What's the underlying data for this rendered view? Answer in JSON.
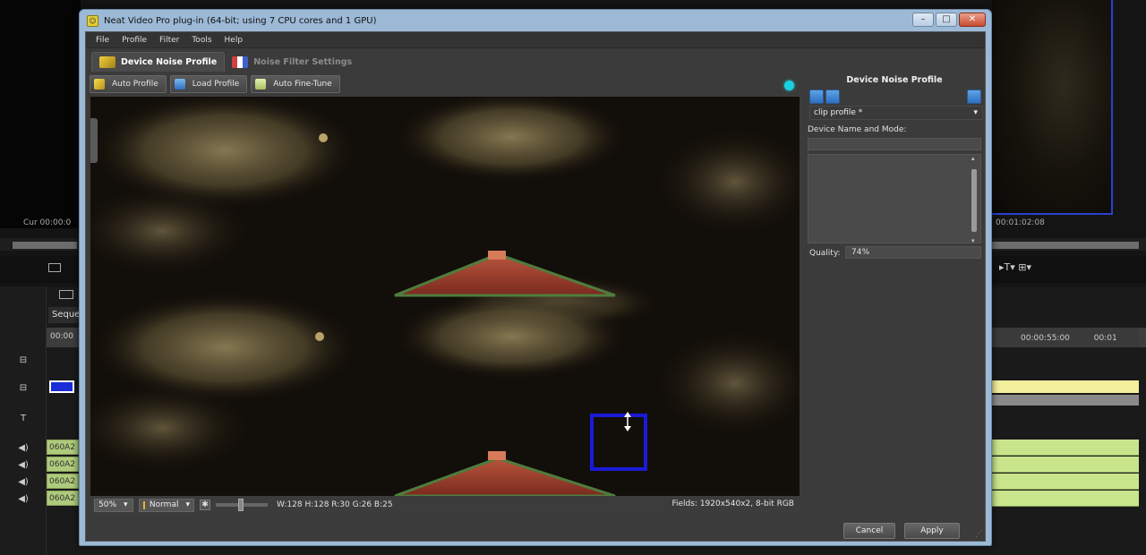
{
  "background_app": {
    "timecode_left": "Cur 00:00:0",
    "timecode_right": "00:01:02:08",
    "sequence_tab": "Seque",
    "ruler_left": "00:00",
    "ruler_right": "00:00:55:00",
    "ruler_far_right": "00:01",
    "clips": [
      "060A2",
      "060A2",
      "060A2",
      "060A2"
    ]
  },
  "dialog": {
    "title": "Neat Video Pro plug-in (64-bit; using 7 CPU cores and 1 GPU)",
    "window_buttons": [
      "–",
      "□",
      "✕"
    ],
    "menu": [
      "File",
      "Profile",
      "Filter",
      "Tools",
      "Help"
    ],
    "tabs": [
      {
        "label": "Device Noise Profile",
        "active": true
      },
      {
        "label": "Noise Filter Settings",
        "active": false
      }
    ],
    "toolbar": {
      "auto_profile": "Auto Profile",
      "load_profile": "Load Profile",
      "auto_fine_tune": "Auto Fine-Tune"
    },
    "viewer_status": {
      "zoom": "50%",
      "mode": "Normal",
      "info": "W:128 H:128  R:30  G:26  B:25",
      "fields": "Fields: 1920x540x2, 8-bit RGB"
    },
    "side_panel": {
      "title": "Device Noise Profile",
      "profile_value": "clip profile *",
      "device_label": "Device Name and Mode:",
      "quality_label": "Quality:",
      "quality_value": "74%"
    },
    "footer": {
      "cancel": "Cancel",
      "apply": "Apply"
    }
  },
  "colors": {
    "dialog_frame": "#9cb9d6",
    "client_bg": "#3b3b3b",
    "status_dot": "#1ad0e0",
    "selection_box": "#1a1ad8",
    "timeline_clip": "#aecb7c"
  },
  "icons": {
    "tab_device": "profile-wizard-icon",
    "tab_filter": "filter-settings-icon",
    "auto_profile": "magic-wand-icon",
    "load_profile": "folder-icon",
    "auto_fine_tune": "tune-icon",
    "status": "status-dot-icon"
  }
}
